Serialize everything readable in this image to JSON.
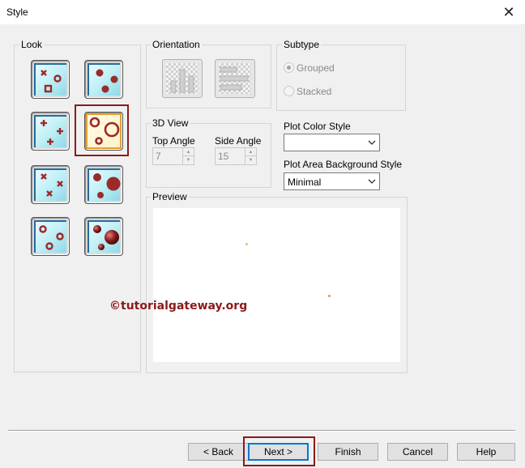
{
  "window": {
    "title": "Style",
    "close_glyph": "✕"
  },
  "look": {
    "label": "Look",
    "styles": [
      {
        "name": "scatter-x-square-circle"
      },
      {
        "name": "scatter-filled-dots"
      },
      {
        "name": "scatter-plus"
      },
      {
        "name": "bubble-rings",
        "selected": true
      },
      {
        "name": "scatter-x"
      },
      {
        "name": "bubble-filled"
      },
      {
        "name": "scatter-rings"
      },
      {
        "name": "bubble-3d-spheres"
      }
    ]
  },
  "orientation": {
    "label": "Orientation",
    "vertical_icon": "vertical-bars-icon",
    "horizontal_icon": "horizontal-bars-icon"
  },
  "subtype": {
    "label": "Subtype",
    "options": [
      "Grouped",
      "Stacked"
    ],
    "selected": "Grouped"
  },
  "view3d": {
    "label": "3D View",
    "top_angle_label": "Top Angle",
    "top_angle_value": "7",
    "side_angle_label": "Side Angle",
    "side_angle_value": "15"
  },
  "plot_color_style": {
    "label": "Plot Color Style",
    "value": ""
  },
  "plot_area_bg": {
    "label": "Plot Area Background Style",
    "value": "Minimal"
  },
  "preview": {
    "label": "Preview"
  },
  "watermark": "©tutorialgateway.org",
  "buttons": {
    "back": "< Back",
    "next": "Next >",
    "finish": "Finish",
    "cancel": "Cancel",
    "help": "Help"
  },
  "colors": {
    "accent_highlight": "#8b1a1a",
    "marker": "#9b2a2a",
    "default_button_border": "#0078d7"
  }
}
